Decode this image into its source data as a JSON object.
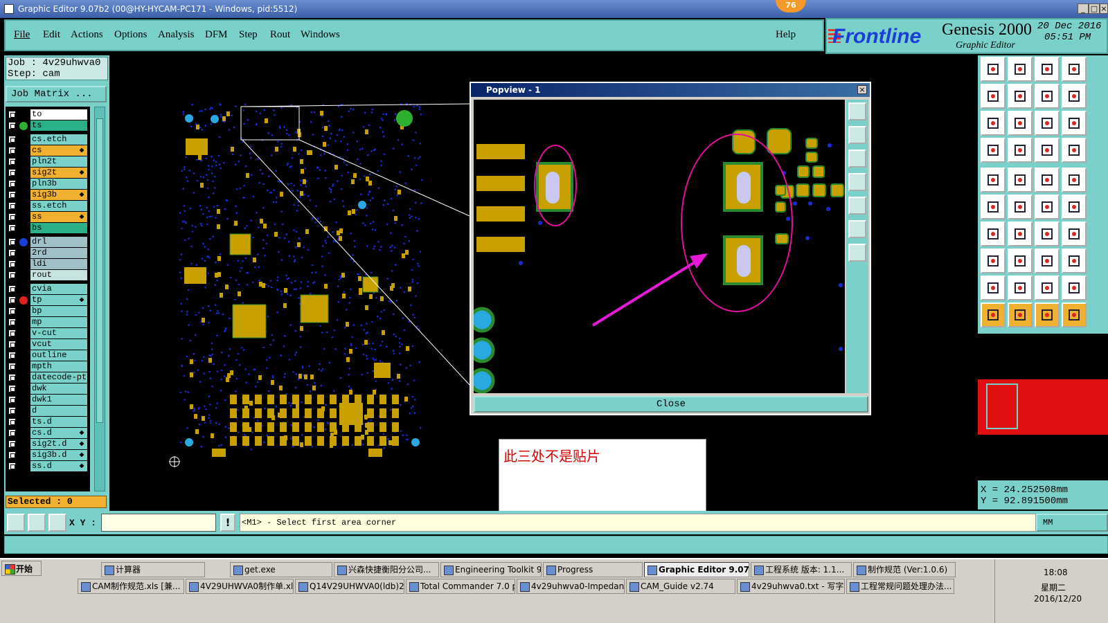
{
  "window": {
    "title": "Graphic Editor 9.07b2 (00@HY-HYCAM-PC171 - Windows, pid:5512)",
    "notif_count": "76",
    "controls": [
      "_",
      "□",
      "×"
    ]
  },
  "menu": {
    "items": [
      "File",
      "Edit",
      "Actions",
      "Options",
      "Analysis",
      "DFM",
      "Step",
      "Rout",
      "Windows"
    ],
    "help": "Help"
  },
  "logo": {
    "brand": "Frontline",
    "product": "Genesis 2000",
    "subtitle": "Graphic Editor",
    "date_line1": "20 Dec 2016",
    "date_line2": "05:51 PM"
  },
  "left": {
    "job": "Job : 4v29uhwva0",
    "step": "Step: cam",
    "job_matrix": "Job Matrix ...",
    "selected": "Selected : 0",
    "layers": [
      {
        "name": "to",
        "highlight": "#ffffff",
        "dot": ""
      },
      {
        "name": "ts",
        "highlight": "#2bb08a",
        "dot": "#2bb030"
      },
      {
        "name": "cs.etch",
        "highlight": "",
        "dot": ""
      },
      {
        "name": "cs",
        "highlight": "#f0b030",
        "dot": "",
        "mark": true
      },
      {
        "name": "pln2t",
        "highlight": "",
        "dot": ""
      },
      {
        "name": "sig2t",
        "highlight": "#f0b030",
        "dot": "",
        "mark": true
      },
      {
        "name": "pln3b",
        "highlight": "",
        "dot": ""
      },
      {
        "name": "sig3b",
        "highlight": "#f0b030",
        "dot": "",
        "mark": true
      },
      {
        "name": "ss.etch",
        "highlight": "",
        "dot": ""
      },
      {
        "name": "ss",
        "highlight": "#f0b030",
        "dot": "",
        "mark": true
      },
      {
        "name": "bs",
        "highlight": "#2bb08a",
        "dot": ""
      },
      {
        "name": "drl",
        "highlight": "#9ec0c6",
        "dot": "#1a3fd6"
      },
      {
        "name": "2rd",
        "highlight": "#9ec0c6",
        "dot": ""
      },
      {
        "name": "ldi",
        "highlight": "#9ec0c6",
        "dot": ""
      },
      {
        "name": "rout",
        "highlight": "#c8e4e0",
        "dot": ""
      },
      {
        "name": "cvia",
        "highlight": "",
        "dot": ""
      },
      {
        "name": "tp",
        "highlight": "",
        "dot": "#e02020",
        "mark": true
      },
      {
        "name": "bp",
        "highlight": "",
        "dot": ""
      },
      {
        "name": "mp",
        "highlight": "",
        "dot": ""
      },
      {
        "name": "v-cut",
        "highlight": "",
        "dot": ""
      },
      {
        "name": "vcut",
        "highlight": "",
        "dot": ""
      },
      {
        "name": "outline",
        "highlight": "",
        "dot": ""
      },
      {
        "name": "mpth",
        "highlight": "",
        "dot": ""
      },
      {
        "name": "datecode-pt",
        "highlight": "",
        "dot": ""
      },
      {
        "name": "dwk",
        "highlight": "",
        "dot": ""
      },
      {
        "name": "dwk1",
        "highlight": "",
        "dot": ""
      },
      {
        "name": "d",
        "highlight": "",
        "dot": ""
      },
      {
        "name": "ts.d",
        "highlight": "",
        "dot": ""
      },
      {
        "name": "cs.d",
        "highlight": "",
        "dot": "",
        "mark": true
      },
      {
        "name": "sig2t.d",
        "highlight": "",
        "dot": "",
        "mark": true
      },
      {
        "name": "sig3b.d",
        "highlight": "",
        "dot": "",
        "mark": true
      },
      {
        "name": "ss.d",
        "highlight": "",
        "dot": "",
        "mark": true
      }
    ]
  },
  "popview": {
    "title": "Popview - 1",
    "close_label": "Close"
  },
  "annotation": {
    "text": "此三处不是贴片"
  },
  "coords": {
    "x": "X = 24.252508mm",
    "y": "Y = 92.891500mm"
  },
  "cmd": {
    "xy_label": "X Y :",
    "xy_value": "",
    "message": "<M1> - Select first area corner",
    "units": "MM"
  },
  "colors": {
    "panel": "#7ad1c9",
    "pad": "#c8a000",
    "pad_edge": "#2a8a30",
    "hole": "#c8c8f0",
    "via": "#1a2ad8",
    "annotation": "#e0109a",
    "arrow": "#e81ad8"
  },
  "taskbar": {
    "start": "开始",
    "row1": [
      {
        "label": "计算器",
        "active": false
      },
      {
        "label": "get.exe",
        "active": false
      },
      {
        "label": "兴森快捷衡阳分公司...",
        "active": false
      },
      {
        "label": "Engineering Toolkit 9.0...",
        "active": false
      },
      {
        "label": "Progress",
        "active": false
      },
      {
        "label": "Graphic Editor 9.07b...",
        "active": true
      },
      {
        "label": "工程系统 版本: 1.1...",
        "active": false
      },
      {
        "label": "制作规范 (Ver:1.0.6)",
        "active": false
      }
    ],
    "row2": [
      {
        "label": "CAM制作规范.xls [兼...",
        "active": false
      },
      {
        "label": "4V29UHWVA0制作单.xls...",
        "active": false
      },
      {
        "label": "Q14V29UHWVA0(ldb)20...",
        "active": false
      },
      {
        "label": "Total Commander 7.0 pu...",
        "active": false
      },
      {
        "label": "4v29uhwva0-Impedance...",
        "active": false
      },
      {
        "label": "CAM_Guide v2.74",
        "active": false
      },
      {
        "label": "4v29uhwva0.txt - 写字板",
        "active": false
      },
      {
        "label": "工程常规问题处理办法...",
        "active": false
      }
    ],
    "time": "18:08",
    "weekday": "星期二",
    "date": "2016/12/20"
  }
}
